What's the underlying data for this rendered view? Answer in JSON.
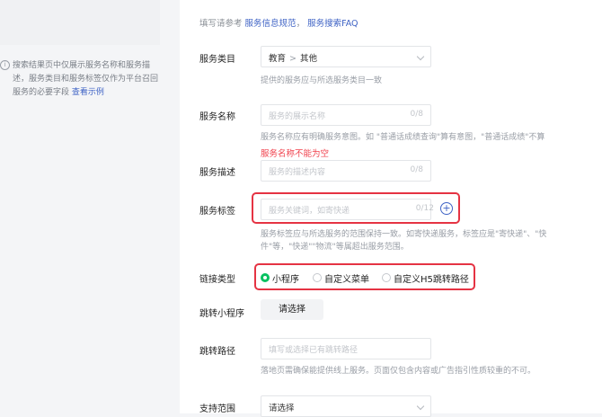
{
  "left_panel": {
    "note": "搜索结果页中仅展示服务名称和服务描述，服务类目和服务标签仅作为平台召回服务的必要字段",
    "link": "查看示例"
  },
  "reference": {
    "prefix": "填写请参考",
    "link1": "服务信息规范",
    "sep": "，",
    "link2": "服务搜索FAQ"
  },
  "category": {
    "label": "服务类目",
    "level1": "教育",
    "separator": ">",
    "level2": "其他",
    "hint": "提供的服务应与所选服务类目一致"
  },
  "service_name": {
    "label": "服务名称",
    "placeholder": "服务的展示名称",
    "count": "0/8",
    "hint": "服务名称应有明确服务意图。如 \"普通话成绩查询\"算有意图，\"普通话成绩\"不算",
    "error": "服务名称不能为空"
  },
  "service_desc": {
    "label": "服务描述",
    "placeholder": "服务的描述内容",
    "count": "0/8"
  },
  "service_tag": {
    "label": "服务标签",
    "placeholder": "服务关键词，如寄快递",
    "count": "0/12",
    "plus": "+",
    "hint_line1": "服务标签应与所选服务的范围保持一致。如寄快递服务，标签应是\"寄快递\"、\"快",
    "hint_line2": "件\"等，\"快递\"\"物流\"等属超出服务范围。"
  },
  "link_type": {
    "label": "链接类型",
    "options": [
      "小程序",
      "自定义菜单",
      "自定义H5跳转路径"
    ],
    "selected_index": 0
  },
  "jump_miniprogram": {
    "label": "跳转小程序",
    "button": "请选择"
  },
  "jump_path": {
    "label": "跳转路径",
    "placeholder": "填写或选择已有跳转路径",
    "hint": "落地页需确保能提供线上服务。页面仅包含内容或广告指引性质较重的不可。"
  },
  "support_scope": {
    "label": "支持范围",
    "value": "请选择"
  },
  "colors": {
    "accent": "#3f63c5",
    "error": "#f0414c",
    "radio_selected": "#07c160",
    "highlight_box": "#e53343"
  }
}
